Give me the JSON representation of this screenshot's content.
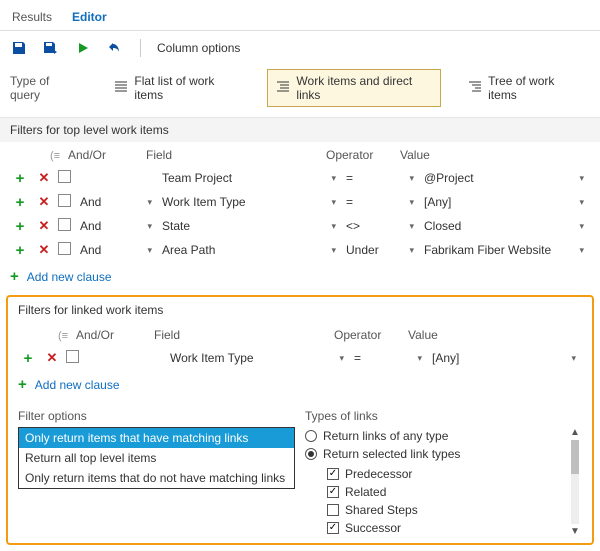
{
  "tabs": {
    "results": "Results",
    "editor": "Editor"
  },
  "toolbar": {
    "column_options": "Column options"
  },
  "query_type": {
    "label": "Type of query",
    "flat": "Flat list of work items",
    "direct": "Work items and direct links",
    "tree": "Tree of work items"
  },
  "top": {
    "title": "Filters for top level work items",
    "headers": {
      "andor": "And/Or",
      "field": "Field",
      "operator": "Operator",
      "value": "Value"
    },
    "rows": [
      {
        "andor": "",
        "field": "Team Project",
        "operator": "=",
        "value": "@Project"
      },
      {
        "andor": "And",
        "field": "Work Item Type",
        "operator": "=",
        "value": "[Any]"
      },
      {
        "andor": "And",
        "field": "State",
        "operator": "<>",
        "value": "Closed"
      },
      {
        "andor": "And",
        "field": "Area Path",
        "operator": "Under",
        "value": "Fabrikam Fiber Website"
      }
    ],
    "add": "Add new clause"
  },
  "linked": {
    "title": "Filters for linked work items",
    "headers": {
      "andor": "And/Or",
      "field": "Field",
      "operator": "Operator",
      "value": "Value"
    },
    "rows": [
      {
        "andor": "",
        "field": "Work Item Type",
        "operator": "=",
        "value": "[Any]"
      }
    ],
    "add": "Add new clause"
  },
  "filter_options": {
    "title": "Filter options",
    "items": [
      "Only return items that have matching links",
      "Return all top level items",
      "Only return items that do not have matching links"
    ]
  },
  "types_of_links": {
    "title": "Types of links",
    "radio_any": "Return links of any type",
    "radio_selected": "Return selected link types",
    "checks": [
      {
        "label": "Predecessor",
        "checked": true
      },
      {
        "label": "Related",
        "checked": true
      },
      {
        "label": "Shared Steps",
        "checked": false
      },
      {
        "label": "Successor",
        "checked": true
      }
    ]
  }
}
